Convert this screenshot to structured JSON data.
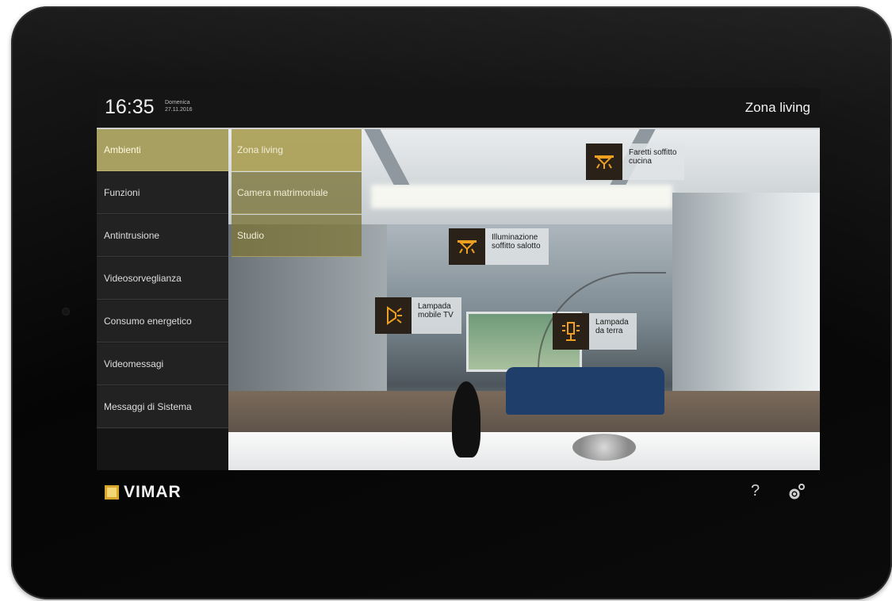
{
  "header": {
    "time": "16:35",
    "day": "Domenica",
    "date": "27.11.2016",
    "zone_title": "Zona living"
  },
  "menu": {
    "items": [
      {
        "label": "Ambienti",
        "active": true
      },
      {
        "label": "Funzioni"
      },
      {
        "label": "Antintrusione"
      },
      {
        "label": "Videosorveglianza"
      },
      {
        "label": "Consumo energetico"
      },
      {
        "label": "Videomessagi"
      },
      {
        "label": "Messaggi di Sistema"
      }
    ]
  },
  "submenu": {
    "items": [
      {
        "label": "Zona living",
        "active": true
      },
      {
        "label": "Camera matrimoniale"
      },
      {
        "label": "Studio"
      }
    ]
  },
  "lights": [
    {
      "line1": "Faretti soffitto",
      "line2": "cucina",
      "icon": "ceiling-spot-icon"
    },
    {
      "line1": "Illuminazione",
      "line2": "soffitto salotto",
      "icon": "ceiling-light-icon"
    },
    {
      "line1": "Lampada",
      "line2": "mobile TV",
      "icon": "wall-lamp-icon"
    },
    {
      "line1": "Lampada",
      "line2": "da terra",
      "icon": "floor-lamp-icon"
    }
  ],
  "footer": {
    "brand": "VIMAR",
    "help_label": "?"
  },
  "colors": {
    "accent": "#a8a060",
    "light_icon": "#f0a020"
  }
}
